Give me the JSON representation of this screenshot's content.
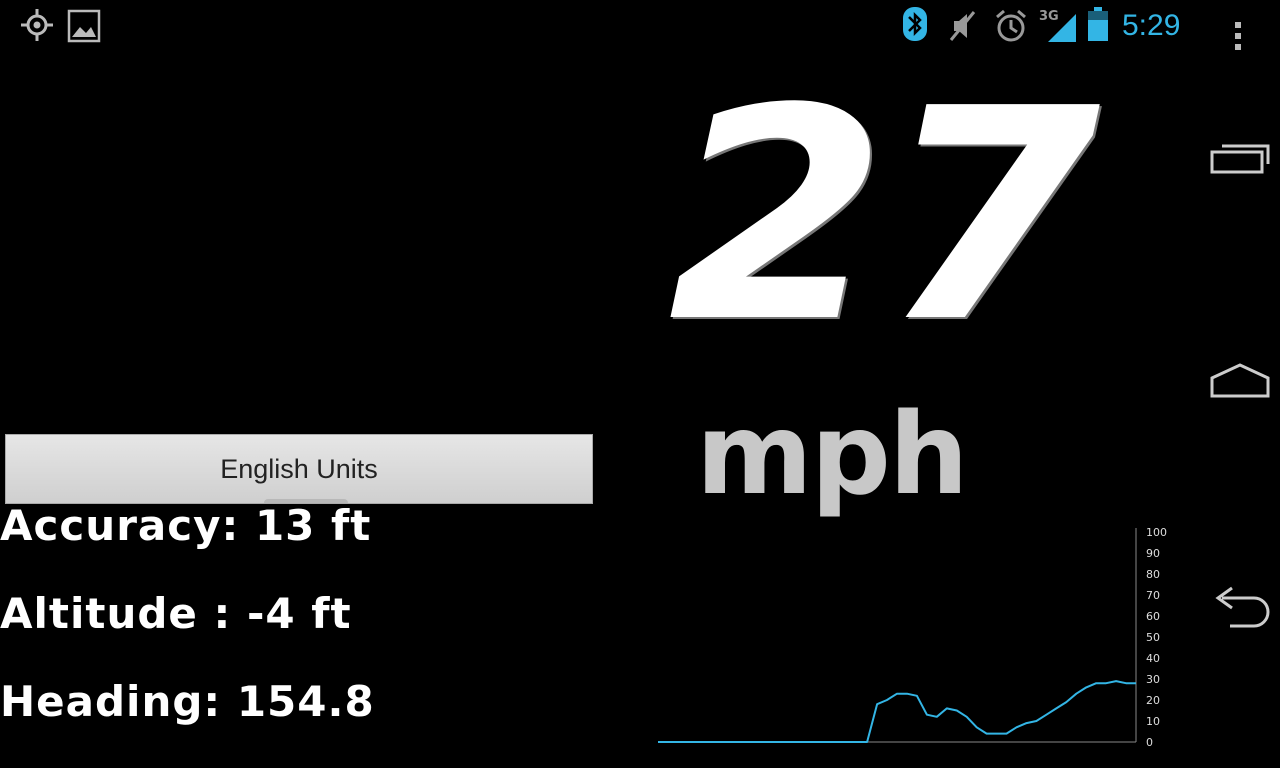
{
  "status_bar": {
    "left_icons": [
      "gps-icon",
      "gallery-icon"
    ],
    "right_icons": [
      "bluetooth-icon",
      "mute-icon",
      "alarm-icon",
      "signal-3g-icon",
      "battery-icon"
    ],
    "network_label": "3G",
    "time": "5:29",
    "accent_color": "#33b5e5"
  },
  "speed": {
    "value": "27",
    "unit": "mph"
  },
  "units_button": {
    "label": "English Units"
  },
  "info": {
    "accuracy": "Accuracy: 13 ft",
    "altitude": "Altitude : -4 ft",
    "heading": "Heading: 154.8"
  },
  "navigation": [
    "recent-apps-icon",
    "home-icon",
    "back-icon"
  ],
  "chart_data": {
    "type": "line",
    "ylim": [
      0,
      100
    ],
    "yticks": [
      0,
      10,
      20,
      30,
      40,
      50,
      60,
      70,
      80,
      90,
      100
    ],
    "line_color": "#33b5e5",
    "x": [
      0,
      10,
      20,
      30,
      40,
      50,
      60,
      70,
      80,
      90,
      100,
      110,
      120,
      130,
      140,
      150,
      160,
      170,
      180,
      190,
      200,
      210,
      220,
      230,
      240,
      250,
      260,
      270,
      280,
      290,
      300,
      310,
      320,
      330,
      340,
      350,
      360,
      370,
      380,
      390,
      400,
      410,
      420,
      430,
      440,
      450,
      460,
      470,
      480
    ],
    "values": [
      0,
      0,
      0,
      0,
      0,
      0,
      0,
      0,
      0,
      0,
      0,
      0,
      0,
      0,
      0,
      0,
      0,
      0,
      0,
      0,
      0,
      0,
      18,
      20,
      23,
      23,
      22,
      13,
      12,
      16,
      15,
      12,
      7,
      4,
      4,
      4,
      7,
      9,
      10,
      13,
      16,
      19,
      23,
      26,
      28,
      28,
      29,
      28,
      28
    ]
  }
}
